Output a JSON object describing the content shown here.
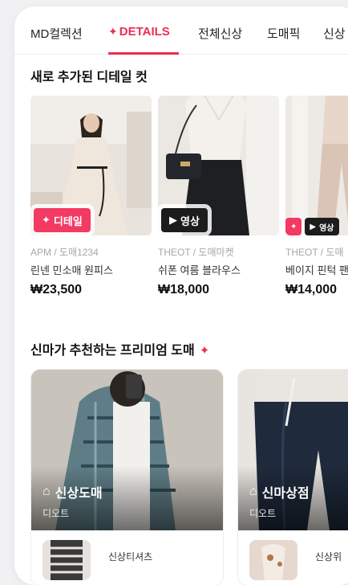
{
  "tabs": [
    {
      "label": "MD컬렉션",
      "active": false
    },
    {
      "label": "DETAILS",
      "active": true,
      "icon": "sparkle-icon"
    },
    {
      "label": "전체신상",
      "active": false
    },
    {
      "label": "도매픽",
      "active": false
    },
    {
      "label": "신상",
      "active": false
    }
  ],
  "sections": {
    "new_details": {
      "title": "새로 추가된 디테일 컷"
    },
    "premium": {
      "title": "신마가 추천하는 프리미엄 도매"
    }
  },
  "products": [
    {
      "shop": "APM / 도매1234",
      "name": "린넨 민소매 원피스",
      "price": "₩23,500",
      "badge": "디테일",
      "badge_icon": "sparkle-icon",
      "badge_style": "red"
    },
    {
      "shop": "THEOT / 도매마켓",
      "name": "쉬폰 여름 블라우스",
      "price": "₩18,000",
      "badge": "영상",
      "badge_icon": "play-icon",
      "badge_style": "dark"
    },
    {
      "shop": "THEOT / 도매",
      "name": "베이지 핀턱 팬",
      "price": "₩14,000",
      "badge": "영상",
      "badge_icon": "play-icon",
      "badge_style": "dark"
    }
  ],
  "premium_cards": [
    {
      "title": "신상도매",
      "sub": "디오트",
      "footer": "신상티셔츠",
      "icon": "home-icon"
    },
    {
      "title": "신마상점",
      "sub": "디오트",
      "footer": "신상위",
      "icon": "home-icon"
    }
  ],
  "colors": {
    "accent": "#ef2d55",
    "badge_dark": "#1c1c1c"
  }
}
